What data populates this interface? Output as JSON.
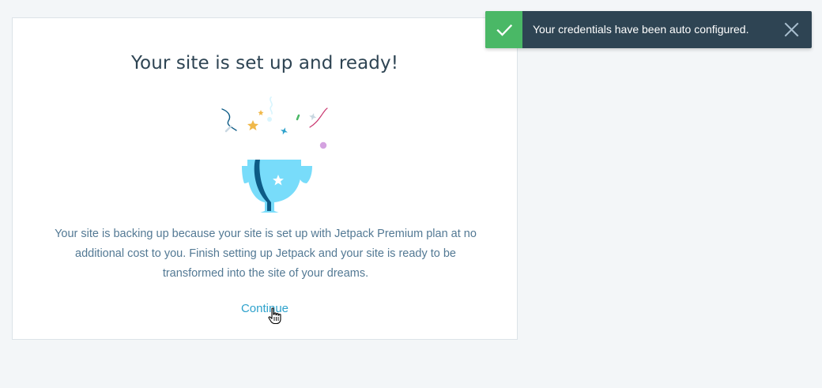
{
  "card": {
    "title": "Your site is set up and ready!",
    "illustration_icon": "trophy-with-confetti-icon",
    "body": "Your site is backing up because your site is set up with Jetpack Premium plan at no additional cost to you. Finish setting up Jetpack and your site is ready to be transformed into the site of your dreams.",
    "continue_label": "Continue"
  },
  "notice": {
    "status": "success",
    "icon": "checkmark-icon",
    "text": "Your credentials have been auto configured.",
    "close_icon": "close-icon"
  },
  "colors": {
    "background": "#f3f6f8",
    "card": "#ffffff",
    "title": "#2e4453",
    "body_text": "#537994",
    "link": "#2ea2cc",
    "notice_bg": "#2e4453",
    "notice_success": "#4ab866",
    "trophy": "#78dcfa",
    "trophy_shadow": "#0d5b86"
  }
}
